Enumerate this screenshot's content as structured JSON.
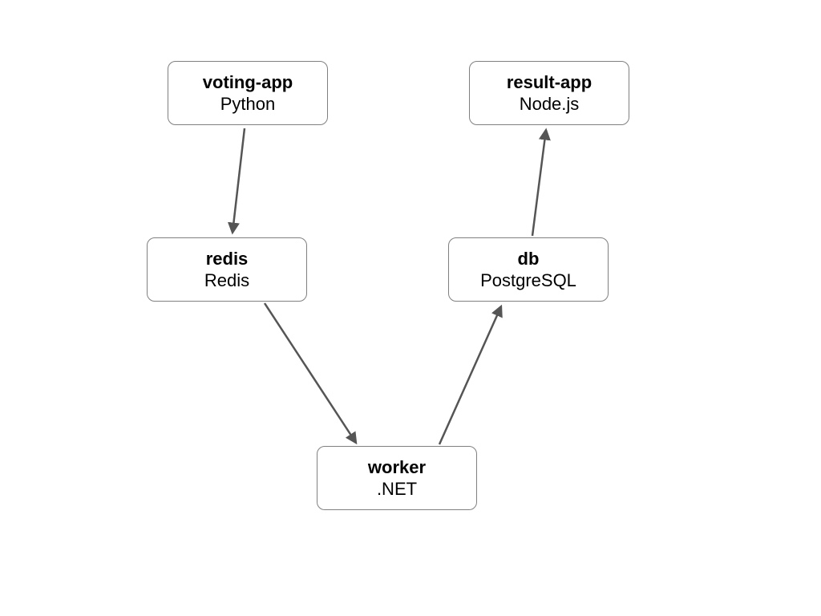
{
  "nodes": {
    "voting_app": {
      "title": "voting-app",
      "subtitle": "Python"
    },
    "result_app": {
      "title": "result-app",
      "subtitle": "Node.js"
    },
    "redis": {
      "title": "redis",
      "subtitle": "Redis"
    },
    "db": {
      "title": "db",
      "subtitle": "PostgreSQL"
    },
    "worker": {
      "title": "worker",
      "subtitle": ".NET"
    }
  },
  "edges": [
    {
      "from": "voting_app",
      "to": "redis"
    },
    {
      "from": "redis",
      "to": "worker"
    },
    {
      "from": "worker",
      "to": "db"
    },
    {
      "from": "db",
      "to": "result_app"
    }
  ],
  "colors": {
    "node_border": "#808080",
    "arrow": "#555555",
    "background": "#ffffff",
    "text": "#000000"
  }
}
